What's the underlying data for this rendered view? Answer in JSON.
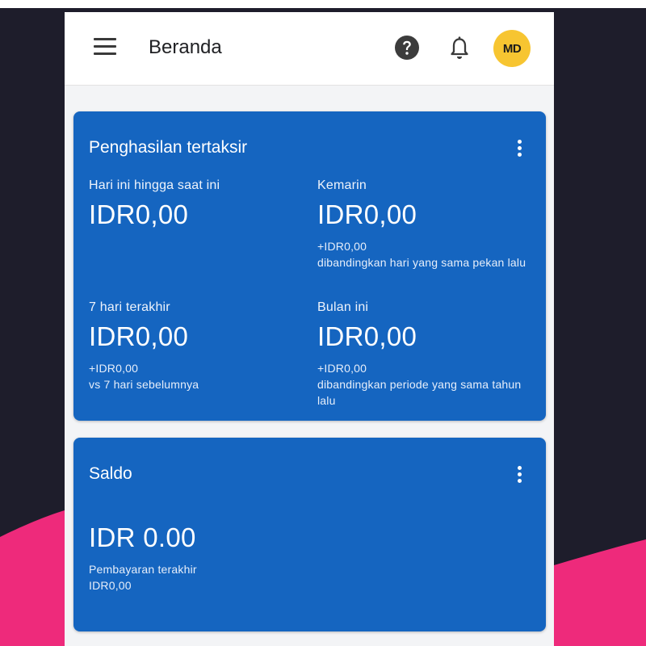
{
  "header": {
    "title": "Beranda",
    "avatar_initials": "MD",
    "icons": [
      "menu-icon",
      "help-icon",
      "bell-icon"
    ]
  },
  "earnings_card": {
    "title": "Penghasilan tertaksir",
    "items": [
      {
        "label": "Hari ini hingga saat ini",
        "value": "IDR0,00",
        "change": "",
        "comparison": ""
      },
      {
        "label": "Kemarin",
        "value": "IDR0,00",
        "change": "+IDR0,00",
        "comparison": "dibandingkan hari yang sama pekan lalu"
      },
      {
        "label": "7 hari terakhir",
        "value": "IDR0,00",
        "change": "+IDR0,00",
        "comparison": "vs 7 hari sebelumnya"
      },
      {
        "label": "Bulan ini",
        "value": "IDR0,00",
        "change": "+IDR0,00",
        "comparison": "dibandingkan periode yang sama tahun lalu"
      }
    ]
  },
  "balance_card": {
    "title": "Saldo",
    "amount": "IDR 0.00",
    "last_payment_label": "Pembayaran terakhir",
    "last_payment_value": "IDR0,00"
  },
  "colors": {
    "card_blue": "#1565c0",
    "avatar_yellow": "#f7c531",
    "background_dark": "#1e1d2b",
    "accent_pink": "#ee2a7b"
  }
}
